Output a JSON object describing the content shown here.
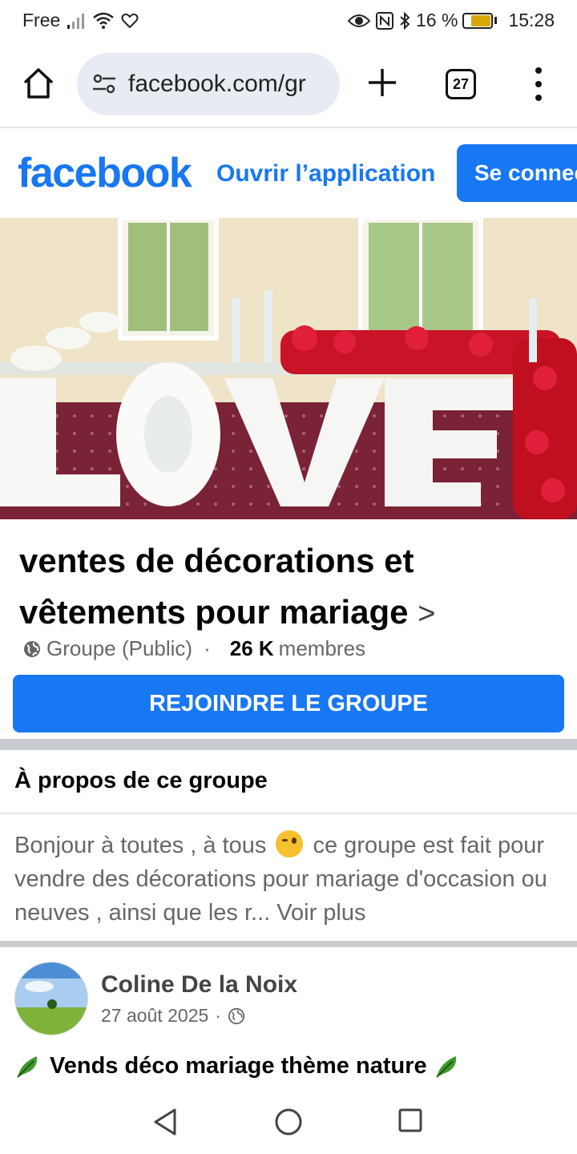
{
  "status_bar": {
    "carrier": "Free",
    "battery_percent": "16 %",
    "time": "15:28"
  },
  "browser": {
    "url": "facebook.com/gr",
    "tab_count": "27"
  },
  "fb_header": {
    "logo": "facebook",
    "open_app": "Ouvrir l’application",
    "login": "Se connecter"
  },
  "group": {
    "title": "ventes de décorations et vêtements pour mariage",
    "chevron": ">",
    "type": "Groupe (Public)",
    "dot": "·",
    "member_count": "26 K",
    "members_label": "membres",
    "join_label": "REJOINDRE LE GROUPE"
  },
  "about": {
    "title": "À propos de ce groupe",
    "text_before": "Bonjour à toutes , à tous",
    "text_after": "ce groupe est fait pour vendre des décorations pour mariage d'occasion ou neuves , ainsi que les r...",
    "voir_plus": "Voir plus"
  },
  "post": {
    "author": "Coline De la Noix",
    "date": "27 août 2025",
    "dot": "·",
    "title": "Vends déco mariage thème nature"
  },
  "icons": {
    "home": "home-icon",
    "site_settings": "site-settings-icon",
    "new_tab": "plus-icon",
    "tabs": "tabs-icon",
    "menu": "more-vert-icon",
    "globe": "globe-icon",
    "leaf": "leaf-emoji-icon",
    "wink": "wink-emoji-icon"
  },
  "colors": {
    "facebook_blue": "#1877f2",
    "divider_gray": "#c9ccd1",
    "secondary_text": "#65676b"
  }
}
